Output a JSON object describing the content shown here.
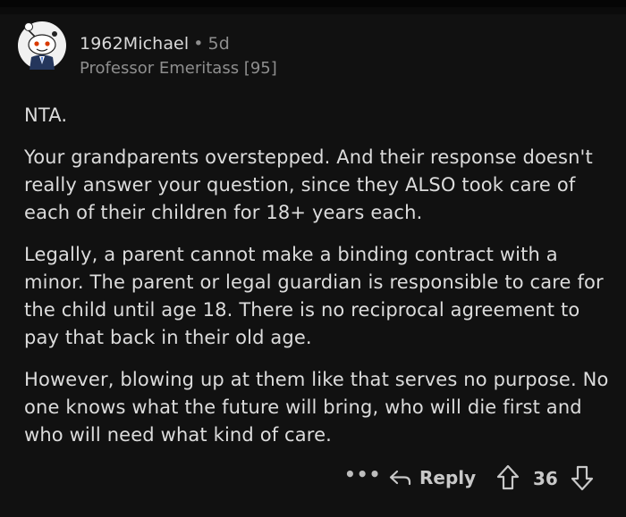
{
  "comment": {
    "author": "1962Michael",
    "separator": "•",
    "age": "5d",
    "flair": "Professor Emeritass [95]",
    "avatar_icon": "snoo-avatar-icon",
    "paragraphs": [
      "NTA.",
      "Your grandparents overstepped.  And their response doesn't really answer your question, since they ALSO took care of each of their children for 18+ years each.",
      "Legally, a parent cannot make a binding contract with a minor.  The parent or legal guardian is responsible to care for the child until age 18.  There is no reciprocal agreement to pay that back in their old age.",
      "However, blowing up at them like that serves no purpose.  No one knows what the future will bring, who will die first and who will need what kind of care."
    ]
  },
  "actions": {
    "more_label": "•••",
    "reply_label": "Reply",
    "score": "36",
    "icons": [
      "more-icon",
      "reply-arrow-icon",
      "upvote-icon",
      "downvote-icon"
    ]
  },
  "colors": {
    "background": "#111111",
    "text": "#dcdcdc",
    "muted": "#8e8e8e"
  }
}
